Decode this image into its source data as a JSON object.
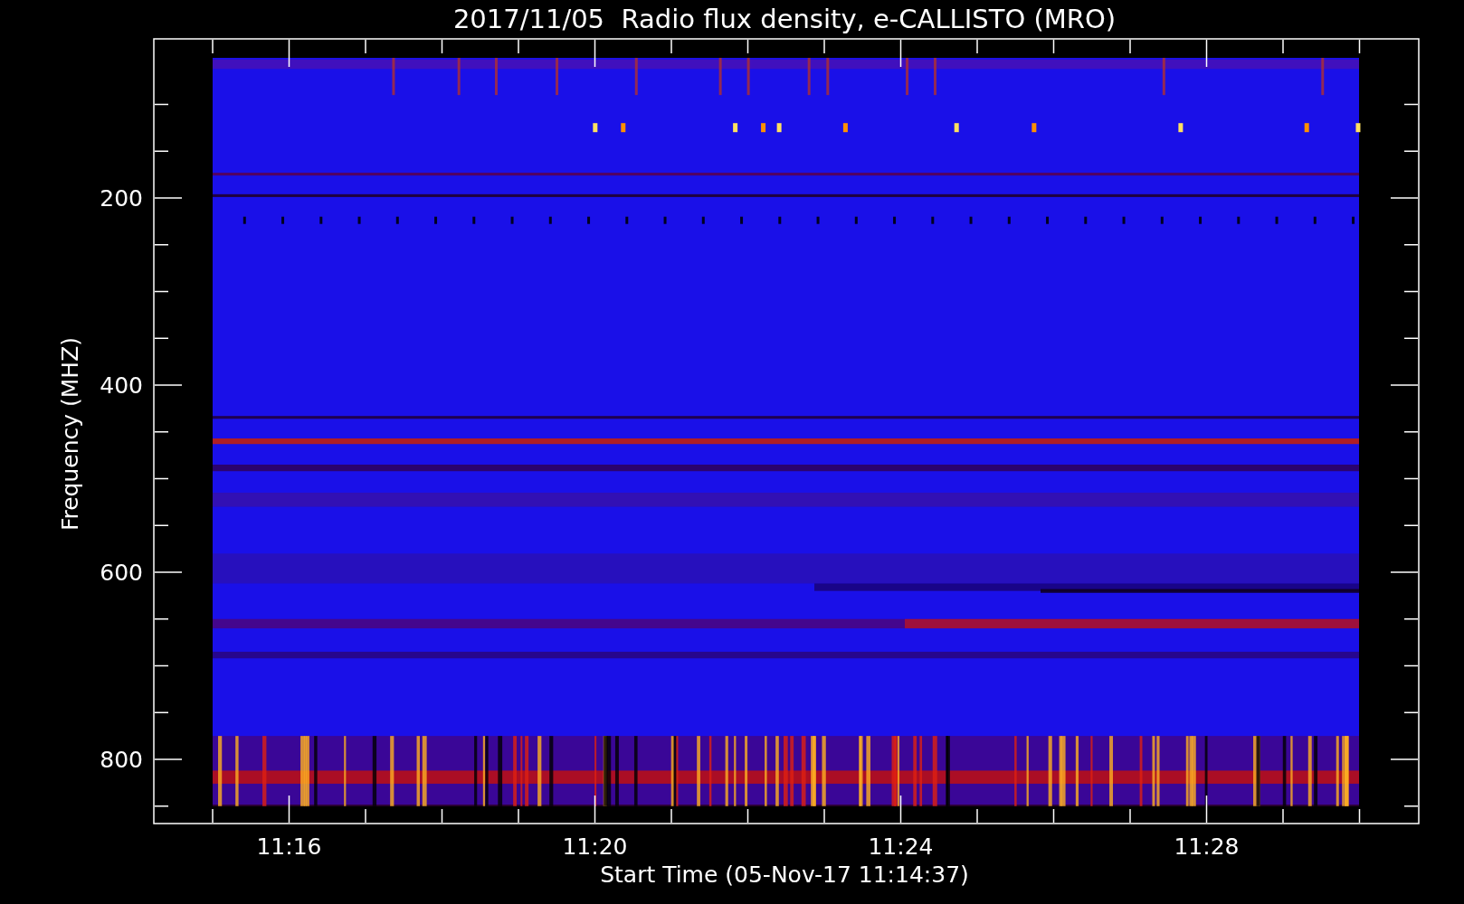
{
  "title": "2017/11/05  Radio flux density, e-CALLISTO (MRO)",
  "y_axis": {
    "label": "Frequency (MHZ)",
    "ticks": [
      "200",
      "400",
      "600",
      "800"
    ]
  },
  "x_axis": {
    "label": "Start Time (05-Nov-17 11:14:37)",
    "ticks": [
      "11:16",
      "11:20",
      "11:24",
      "11:28"
    ]
  }
}
